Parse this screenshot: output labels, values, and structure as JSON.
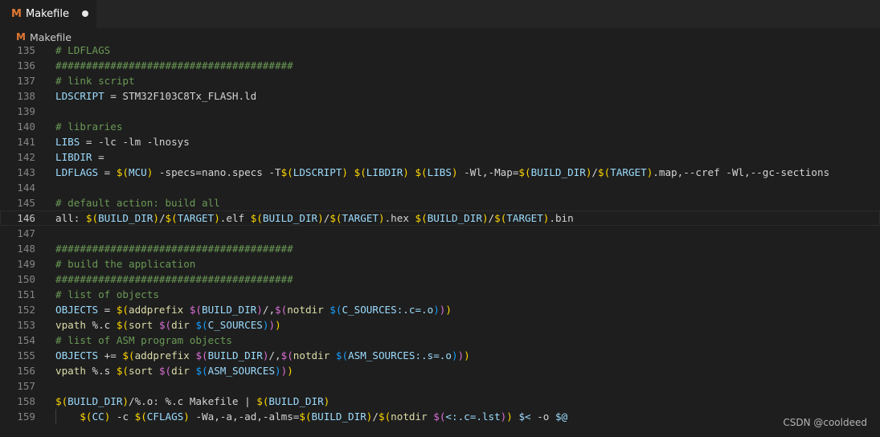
{
  "tab": {
    "title": "Makefile",
    "icon": "M",
    "modified": true
  },
  "breadcrumb": {
    "icon": "M",
    "label": "Makefile"
  },
  "current_line": "146",
  "lines": [
    {
      "n": "135",
      "t": [
        [
          "c",
          "# LDFLAGS"
        ]
      ]
    },
    {
      "n": "136",
      "t": [
        [
          "c",
          "#######################################"
        ]
      ]
    },
    {
      "n": "137",
      "t": [
        [
          "c",
          "# link script"
        ]
      ]
    },
    {
      "n": "138",
      "t": [
        [
          "v",
          "LDSCRIPT"
        ],
        [
          "w",
          " = STM32F103C8Tx_FLASH.ld"
        ]
      ]
    },
    {
      "n": "139",
      "t": []
    },
    {
      "n": "140",
      "t": [
        [
          "c",
          "# libraries"
        ]
      ]
    },
    {
      "n": "141",
      "t": [
        [
          "v",
          "LIBS"
        ],
        [
          "w",
          " = -lc -lm -lnosys"
        ]
      ]
    },
    {
      "n": "142",
      "t": [
        [
          "v",
          "LIBDIR"
        ],
        [
          "w",
          " ="
        ]
      ]
    },
    {
      "n": "143",
      "t": [
        [
          "v",
          "LDFLAGS"
        ],
        [
          "w",
          " = "
        ],
        [
          "b1",
          "$("
        ],
        [
          "v",
          "MCU"
        ],
        [
          "b1",
          ")"
        ],
        [
          "w",
          " -specs=nano.specs -T"
        ],
        [
          "b1",
          "$("
        ],
        [
          "v",
          "LDSCRIPT"
        ],
        [
          "b1",
          ")"
        ],
        [
          "w",
          " "
        ],
        [
          "b1",
          "$("
        ],
        [
          "v",
          "LIBDIR"
        ],
        [
          "b1",
          ")"
        ],
        [
          "w",
          " "
        ],
        [
          "b1",
          "$("
        ],
        [
          "v",
          "LIBS"
        ],
        [
          "b1",
          ")"
        ],
        [
          "w",
          " -Wl,-Map="
        ],
        [
          "b1",
          "$("
        ],
        [
          "v",
          "BUILD_DIR"
        ],
        [
          "b1",
          ")"
        ],
        [
          "w",
          "/"
        ],
        [
          "b1",
          "$("
        ],
        [
          "v",
          "TARGET"
        ],
        [
          "b1",
          ")"
        ],
        [
          "w",
          ".map,--cref -Wl,--gc-sections"
        ]
      ]
    },
    {
      "n": "144",
      "t": []
    },
    {
      "n": "145",
      "t": [
        [
          "c",
          "# default action: build all"
        ]
      ]
    },
    {
      "n": "146",
      "t": [
        [
          "w",
          "all: "
        ],
        [
          "b1",
          "$("
        ],
        [
          "v",
          "BUILD_DIR"
        ],
        [
          "b1",
          ")"
        ],
        [
          "w",
          "/"
        ],
        [
          "b1",
          "$("
        ],
        [
          "v",
          "TARGET"
        ],
        [
          "b1",
          ")"
        ],
        [
          "w",
          ".elf "
        ],
        [
          "b1",
          "$("
        ],
        [
          "v",
          "BUILD_DIR"
        ],
        [
          "b1",
          ")"
        ],
        [
          "w",
          "/"
        ],
        [
          "b1",
          "$("
        ],
        [
          "v",
          "TARGET"
        ],
        [
          "b1",
          ")"
        ],
        [
          "w",
          ".hex "
        ],
        [
          "b1",
          "$("
        ],
        [
          "v",
          "BUILD_DIR"
        ],
        [
          "b1",
          ")"
        ],
        [
          "w",
          "/"
        ],
        [
          "b1",
          "$("
        ],
        [
          "v",
          "TARGET"
        ],
        [
          "b1",
          ")"
        ],
        [
          "w",
          ".bin"
        ]
      ]
    },
    {
      "n": "147",
      "t": []
    },
    {
      "n": "148",
      "t": [
        [
          "c",
          "#######################################"
        ]
      ]
    },
    {
      "n": "149",
      "t": [
        [
          "c",
          "# build the application"
        ]
      ]
    },
    {
      "n": "150",
      "t": [
        [
          "c",
          "#######################################"
        ]
      ]
    },
    {
      "n": "151",
      "t": [
        [
          "c",
          "# list of objects"
        ]
      ]
    },
    {
      "n": "152",
      "t": [
        [
          "v",
          "OBJECTS"
        ],
        [
          "w",
          " = "
        ],
        [
          "b1",
          "$("
        ],
        [
          "f",
          "addprefix"
        ],
        [
          "w",
          " "
        ],
        [
          "b2",
          "$("
        ],
        [
          "v",
          "BUILD_DIR"
        ],
        [
          "b2",
          ")"
        ],
        [
          "w",
          "/,"
        ],
        [
          "b2",
          "$("
        ],
        [
          "f",
          "notdir"
        ],
        [
          "w",
          " "
        ],
        [
          "b3",
          "$("
        ],
        [
          "v",
          "C_SOURCES:.c=.o"
        ],
        [
          "b3",
          ")"
        ],
        [
          "b2",
          ")"
        ],
        [
          "b1",
          ")"
        ]
      ]
    },
    {
      "n": "153",
      "t": [
        [
          "f",
          "vpath"
        ],
        [
          "w",
          " %.c "
        ],
        [
          "b1",
          "$("
        ],
        [
          "f",
          "sort"
        ],
        [
          "w",
          " "
        ],
        [
          "b2",
          "$("
        ],
        [
          "f",
          "dir"
        ],
        [
          "w",
          " "
        ],
        [
          "b3",
          "$("
        ],
        [
          "v",
          "C_SOURCES"
        ],
        [
          "b3",
          ")"
        ],
        [
          "b2",
          ")"
        ],
        [
          "b1",
          ")"
        ]
      ]
    },
    {
      "n": "154",
      "t": [
        [
          "c",
          "# list of ASM program objects"
        ]
      ]
    },
    {
      "n": "155",
      "t": [
        [
          "v",
          "OBJECTS"
        ],
        [
          "w",
          " += "
        ],
        [
          "b1",
          "$("
        ],
        [
          "f",
          "addprefix"
        ],
        [
          "w",
          " "
        ],
        [
          "b2",
          "$("
        ],
        [
          "v",
          "BUILD_DIR"
        ],
        [
          "b2",
          ")"
        ],
        [
          "w",
          "/,"
        ],
        [
          "b2",
          "$("
        ],
        [
          "f",
          "notdir"
        ],
        [
          "w",
          " "
        ],
        [
          "b3",
          "$("
        ],
        [
          "v",
          "ASM_SOURCES:.s=.o"
        ],
        [
          "b3",
          ")"
        ],
        [
          "b2",
          ")"
        ],
        [
          "b1",
          ")"
        ]
      ]
    },
    {
      "n": "156",
      "t": [
        [
          "f",
          "vpath"
        ],
        [
          "w",
          " %.s "
        ],
        [
          "b1",
          "$("
        ],
        [
          "f",
          "sort"
        ],
        [
          "w",
          " "
        ],
        [
          "b2",
          "$("
        ],
        [
          "f",
          "dir"
        ],
        [
          "w",
          " "
        ],
        [
          "b3",
          "$("
        ],
        [
          "v",
          "ASM_SOURCES"
        ],
        [
          "b3",
          ")"
        ],
        [
          "b2",
          ")"
        ],
        [
          "b1",
          ")"
        ]
      ]
    },
    {
      "n": "157",
      "t": []
    },
    {
      "n": "158",
      "t": [
        [
          "b1",
          "$("
        ],
        [
          "v",
          "BUILD_DIR"
        ],
        [
          "b1",
          ")"
        ],
        [
          "w",
          "/%.o: %.c Makefile | "
        ],
        [
          "b1",
          "$("
        ],
        [
          "v",
          "BUILD_DIR"
        ],
        [
          "b1",
          ")"
        ]
      ]
    },
    {
      "n": "159",
      "indent": "    ",
      "t": [
        [
          "b1",
          "$("
        ],
        [
          "v",
          "CC"
        ],
        [
          "b1",
          ")"
        ],
        [
          "w",
          " -c "
        ],
        [
          "b1",
          "$("
        ],
        [
          "v",
          "CFLAGS"
        ],
        [
          "b1",
          ")"
        ],
        [
          "w",
          " -Wa,-a,-ad,-alms="
        ],
        [
          "b1",
          "$("
        ],
        [
          "v",
          "BUILD_DIR"
        ],
        [
          "b1",
          ")"
        ],
        [
          "w",
          "/"
        ],
        [
          "b1",
          "$("
        ],
        [
          "f",
          "notdir"
        ],
        [
          "w",
          " "
        ],
        [
          "b2",
          "$("
        ],
        [
          "v",
          "<:.c=.lst"
        ],
        [
          "b2",
          ")"
        ],
        [
          "b1",
          ")"
        ],
        [
          "w",
          " "
        ],
        [
          "v",
          "$<"
        ],
        [
          "w",
          " -o "
        ],
        [
          "v",
          "$@"
        ]
      ]
    }
  ],
  "watermark": "CSDN @cooldeed"
}
